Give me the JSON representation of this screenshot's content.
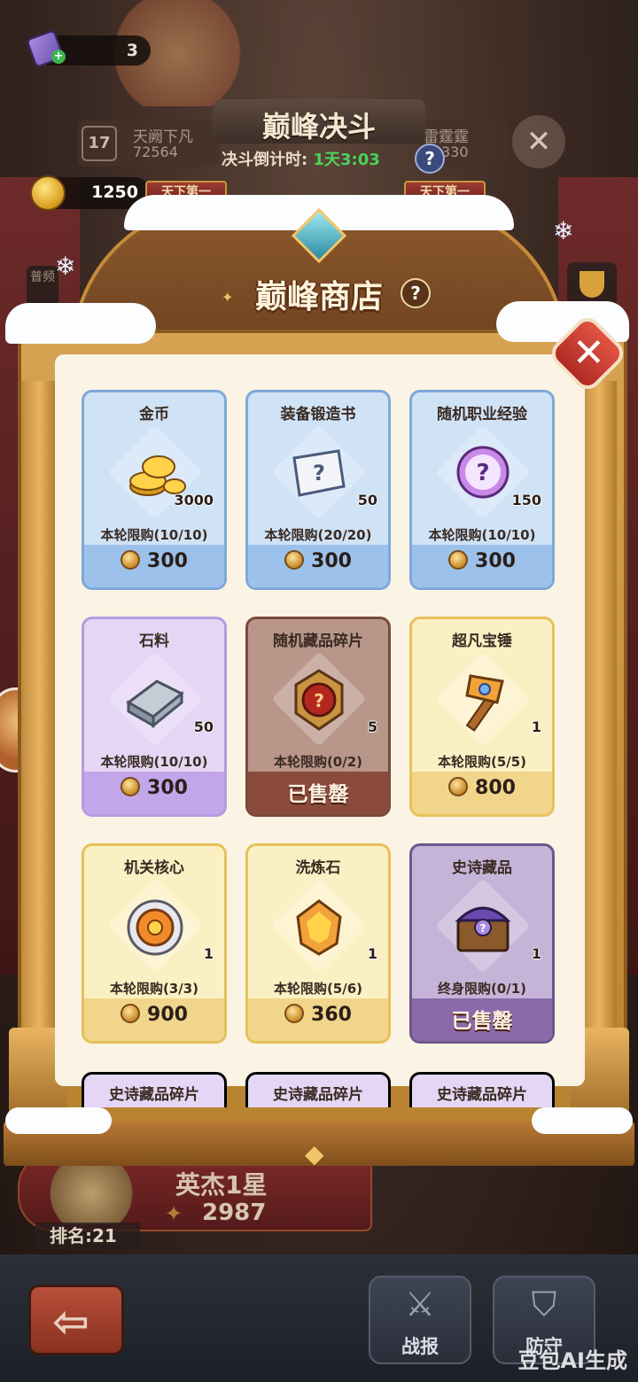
{
  "header": {
    "ticket_count": "3",
    "title": "巅峰决斗",
    "countdown_label": "决斗倒计时:",
    "countdown_value": "1天3:03",
    "left_player": {
      "level": "17",
      "name": "天阙下凡",
      "score": "72564"
    },
    "right_player": {
      "name": "雷霆霆",
      "score": "330"
    },
    "gold": "1250",
    "banner_left": "天下第一",
    "banner_right": "天下第一",
    "side_tab": "普频"
  },
  "shop": {
    "title": "巅峰商店",
    "help": "?",
    "close": "✕",
    "items": [
      {
        "name": "金币",
        "qty": "3000",
        "limit": "本轮限购(10/10)",
        "price": "300",
        "status": "available",
        "theme": "blue",
        "icon": "gold-coins-icon"
      },
      {
        "name": "装备锻造书",
        "qty": "50",
        "limit": "本轮限购(20/20)",
        "price": "300",
        "status": "available",
        "theme": "blue",
        "icon": "scroll-icon"
      },
      {
        "name": "随机职业经验",
        "qty": "150",
        "limit": "本轮限购(10/10)",
        "price": "300",
        "status": "available",
        "theme": "blue",
        "icon": "mystery-orb-icon"
      },
      {
        "name": "石料",
        "qty": "50",
        "limit": "本轮限购(10/10)",
        "price": "300",
        "status": "available",
        "theme": "purple",
        "icon": "stone-bricks-icon"
      },
      {
        "name": "随机藏品碎片",
        "qty": "5",
        "limit": "本轮限购(0/2)",
        "price": "已售罄",
        "status": "soldout",
        "theme": "brown",
        "icon": "relic-fragment-icon"
      },
      {
        "name": "超凡宝锤",
        "qty": "1",
        "limit": "本轮限购(5/5)",
        "price": "800",
        "status": "available",
        "theme": "yellow",
        "icon": "hammer-icon"
      },
      {
        "name": "机关核心",
        "qty": "1",
        "limit": "本轮限购(3/3)",
        "price": "900",
        "status": "available",
        "theme": "yellow",
        "icon": "gear-core-icon"
      },
      {
        "name": "洗炼石",
        "qty": "1",
        "limit": "本轮限购(5/6)",
        "price": "360",
        "status": "available",
        "theme": "yellow",
        "icon": "refine-stone-icon"
      },
      {
        "name": "史诗藏品",
        "qty": "1",
        "limit": "终身限购(0/1)",
        "price": "已售罄",
        "status": "soldout",
        "theme": "violet",
        "icon": "treasure-chest-icon"
      }
    ],
    "partial_items": [
      "史诗藏品碎片",
      "史诗藏品碎片",
      "史诗藏品碎片"
    ]
  },
  "footer": {
    "tier": "英杰1星",
    "points": "2987",
    "rank": "排名:21",
    "nav_report": "战报",
    "nav_defense": "防守",
    "watermark": "豆包AI生成"
  },
  "colors": {
    "frame_gold": "#d6a353",
    "panel_cream": "#fbf3e4",
    "close_red": "#e25444",
    "countdown_green": "#49d35a"
  }
}
